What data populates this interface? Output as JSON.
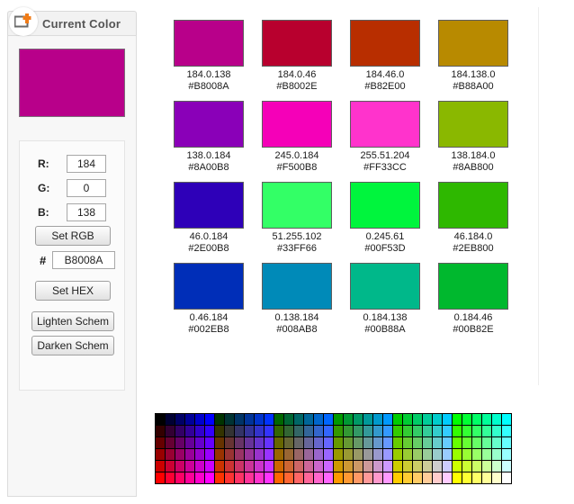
{
  "tab": {
    "title": "Current Color",
    "icon": "add-color-icon"
  },
  "sidebar": {
    "current_color_hex": "#B8008A",
    "fields": [
      {
        "label": "R:",
        "value": "184",
        "name": "red"
      },
      {
        "label": "G:",
        "value": "0",
        "name": "green"
      },
      {
        "label": "B:",
        "value": "138",
        "name": "blue"
      }
    ],
    "set_rgb_label": "Set RGB",
    "hash_symbol": "#",
    "hex_value": "B8008A",
    "set_hex_label": "Set HEX",
    "lighten_label": "Lighten Schem",
    "darken_label": "Darken Schem"
  },
  "scheme": {
    "swatches": [
      {
        "rgb": "184.0.138",
        "hex": "#B8008A"
      },
      {
        "rgb": "184.0.46",
        "hex": "#B8002E"
      },
      {
        "rgb": "184.46.0",
        "hex": "#B82E00"
      },
      {
        "rgb": "184.138.0",
        "hex": "#B88A00"
      },
      {
        "rgb": "138.0.184",
        "hex": "#8A00B8"
      },
      {
        "rgb": "245.0.184",
        "hex": "#F500B8"
      },
      {
        "rgb": "255.51.204",
        "hex": "#FF33CC"
      },
      {
        "rgb": "138.184.0",
        "hex": "#8AB800"
      },
      {
        "rgb": "46.0.184",
        "hex": "#2E00B8"
      },
      {
        "rgb": "51.255.102",
        "hex": "#33FF66"
      },
      {
        "rgb": "0.245.61",
        "hex": "#00F53D"
      },
      {
        "rgb": "46.184.0",
        "hex": "#2EB800"
      },
      {
        "rgb": "0.46.184",
        "hex": "#002EB8"
      },
      {
        "rgb": "0.138.184",
        "hex": "#008AB8"
      },
      {
        "rgb": "0.184.138",
        "hex": "#00B88A"
      },
      {
        "rgb": "0.184.46",
        "hex": "#00B82E"
      }
    ]
  },
  "palette": {
    "levels": [
      0,
      51,
      102,
      153,
      204,
      255
    ],
    "columns": 36,
    "rows": 6
  }
}
